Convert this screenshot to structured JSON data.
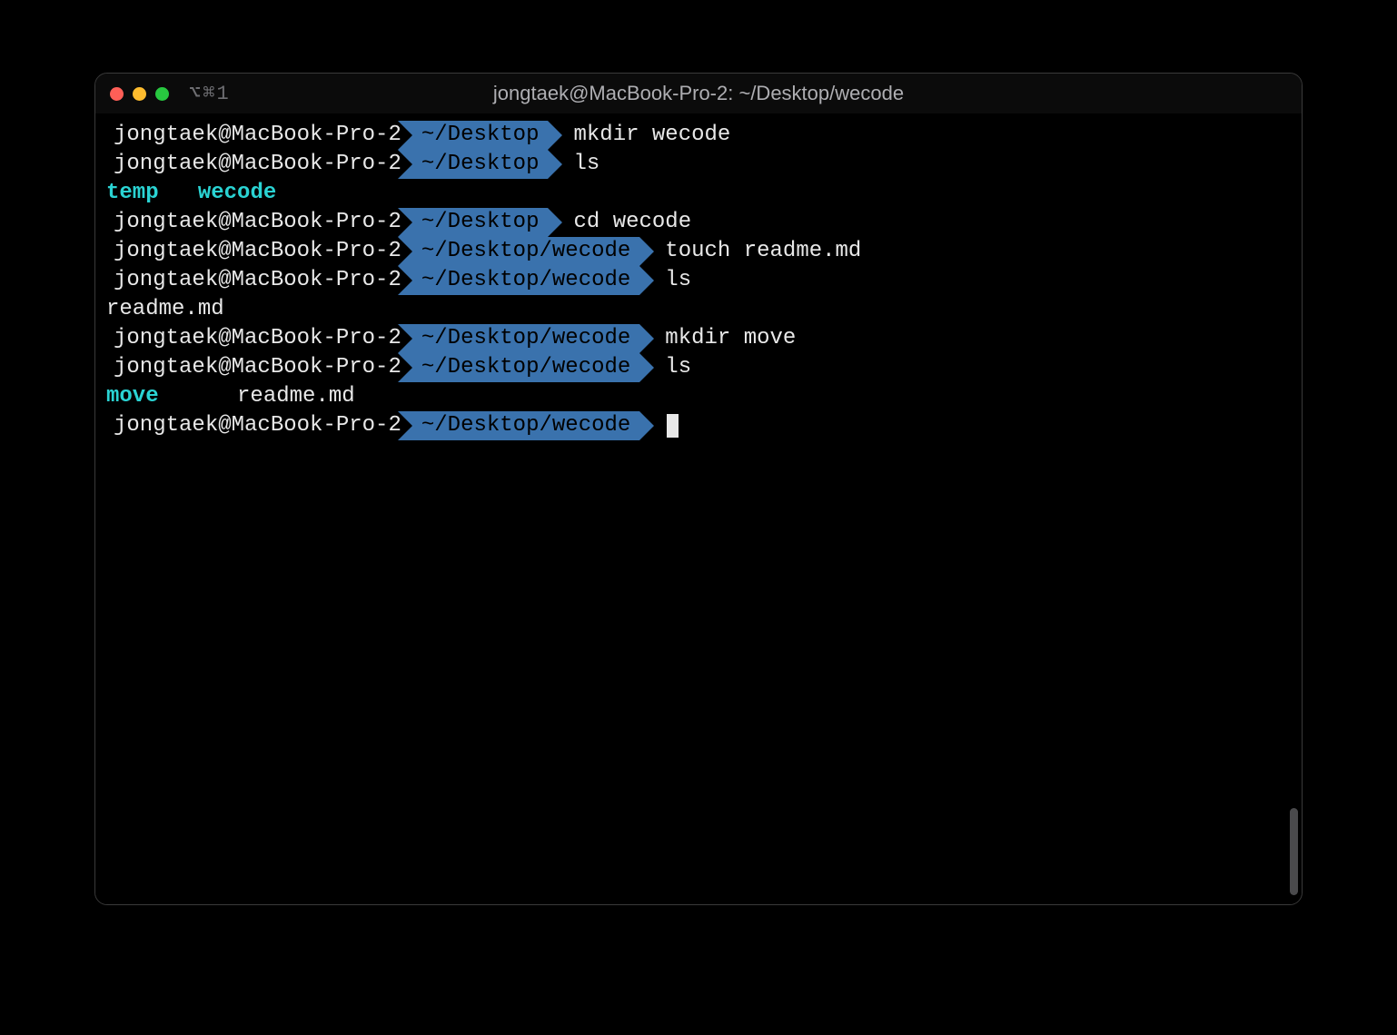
{
  "window": {
    "title": "jongtaek@MacBook-Pro-2: ~/Desktop/wecode",
    "tab_indicator": "⌥⌘1"
  },
  "prompt_host": "jongtaek@MacBook-Pro-2",
  "lines": [
    {
      "type": "prompt",
      "path": "~/Desktop",
      "command": "mkdir wecode"
    },
    {
      "type": "prompt",
      "path": "~/Desktop",
      "command": "ls"
    },
    {
      "type": "output_ls1",
      "dir1": "temp",
      "gap1": "   ",
      "dir2": "wecode"
    },
    {
      "type": "prompt",
      "path": "~/Desktop",
      "command": "cd wecode"
    },
    {
      "type": "prompt",
      "path": "~/Desktop/wecode",
      "command": "touch readme.md"
    },
    {
      "type": "prompt",
      "path": "~/Desktop/wecode",
      "command": "ls"
    },
    {
      "type": "output_plain",
      "text": "readme.md"
    },
    {
      "type": "prompt",
      "path": "~/Desktop/wecode",
      "command": "mkdir move"
    },
    {
      "type": "prompt",
      "path": "~/Desktop/wecode",
      "command": "ls"
    },
    {
      "type": "output_ls2",
      "dir1": "move",
      "gap1": "      ",
      "file1": "readme.md"
    },
    {
      "type": "prompt_cursor",
      "path": "~/Desktop/wecode"
    }
  ]
}
